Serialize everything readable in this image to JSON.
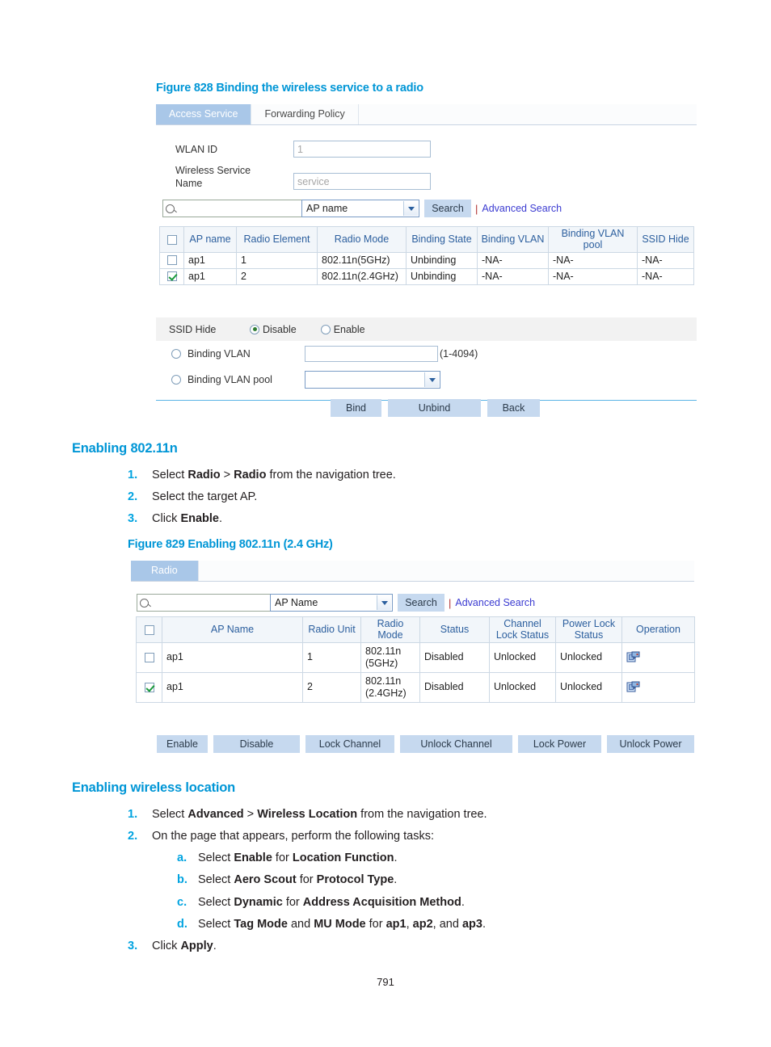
{
  "page": {
    "number": "791"
  },
  "figure828": {
    "caption": "Figure 828 Binding the wireless service to a radio",
    "tabs": [
      {
        "label": "Access Service",
        "active": true
      },
      {
        "label": "Forwarding Policy",
        "active": false
      }
    ],
    "fields": [
      {
        "label": "WLAN ID",
        "value": "1"
      },
      {
        "label": "Wireless Service Name",
        "value": "service"
      }
    ],
    "search": {
      "query": "",
      "criteria": "AP name",
      "button": "Search",
      "advanced_link": "Advanced Search",
      "search_icon": "magnifier-icon"
    },
    "table": {
      "columns": [
        "AP name",
        "Radio Element",
        "Radio Mode",
        "Binding State",
        "Binding VLAN",
        "Binding VLAN pool",
        "SSID Hide"
      ],
      "rows": [
        {
          "checked": false,
          "cells": [
            "ap1",
            "1",
            "802.11n(5GHz)",
            "Unbinding",
            "-NA-",
            "-NA-",
            "-NA-"
          ]
        },
        {
          "checked": true,
          "cells": [
            "ap1",
            "2",
            "802.11n(2.4GHz)",
            "Unbinding",
            "-NA-",
            "-NA-",
            "-NA-"
          ]
        }
      ]
    },
    "ssid_hide": {
      "label": "SSID Hide",
      "options": [
        {
          "label": "Disable",
          "selected": true
        },
        {
          "label": "Enable",
          "selected": false
        }
      ]
    },
    "binding_vlan": {
      "label": "Binding VLAN",
      "selected": false,
      "value": "",
      "range_hint": "(1-4094)"
    },
    "binding_vlan_pool": {
      "label": "Binding VLAN pool",
      "selected": false,
      "value": ""
    },
    "buttons": [
      "Bind",
      "Unbind",
      "Back"
    ]
  },
  "section_80211n": {
    "heading": "Enabling 802.11n",
    "steps": [
      {
        "num": "1.",
        "parts": [
          {
            "t": "Select ",
            "b": false
          },
          {
            "t": "Radio",
            "b": true
          },
          {
            "t": " > ",
            "b": false
          },
          {
            "t": "Radio",
            "b": true
          },
          {
            "t": " from the navigation tree.",
            "b": false
          }
        ]
      },
      {
        "num": "2.",
        "parts": [
          {
            "t": "Select the target AP.",
            "b": false
          }
        ]
      },
      {
        "num": "3.",
        "parts": [
          {
            "t": "Click ",
            "b": false
          },
          {
            "t": "Enable",
            "b": true
          },
          {
            "t": ".",
            "b": false
          }
        ]
      }
    ]
  },
  "figure829": {
    "caption": "Figure 829 Enabling 802.11n (2.4 GHz)",
    "tabs": [
      {
        "label": "Radio",
        "active": true
      }
    ],
    "search": {
      "query": "",
      "criteria": "AP Name",
      "button": "Search",
      "advanced_link": "Advanced Search",
      "search_icon": "magnifier-icon"
    },
    "table": {
      "columns": [
        "AP Name",
        "Radio Unit",
        "Radio Mode",
        "Status",
        "Channel Lock Status",
        "Power Lock Status",
        "Operation"
      ],
      "rows": [
        {
          "checked": false,
          "cells": [
            "ap1",
            "1",
            "802.11n (5GHz)",
            "Disabled",
            "Unlocked",
            "Unlocked"
          ],
          "operation_icon": "edit-config-icon"
        },
        {
          "checked": true,
          "cells": [
            "ap1",
            "2",
            "802.11n (2.4GHz)",
            "Disabled",
            "Unlocked",
            "Unlocked"
          ],
          "operation_icon": "edit-config-icon"
        }
      ]
    },
    "buttons": [
      "Enable",
      "Disable",
      "Lock Channel",
      "Unlock Channel",
      "Lock Power",
      "Unlock Power"
    ]
  },
  "section_wireless_location": {
    "heading": "Enabling wireless location",
    "steps": [
      {
        "num": "1.",
        "parts": [
          {
            "t": "Select ",
            "b": false
          },
          {
            "t": "Advanced",
            "b": true
          },
          {
            "t": " > ",
            "b": false
          },
          {
            "t": "Wireless Location",
            "b": true
          },
          {
            "t": " from the navigation tree.",
            "b": false
          }
        ]
      },
      {
        "num": "2.",
        "parts": [
          {
            "t": "On the page that appears, perform the following tasks:",
            "b": false
          }
        ],
        "substeps": [
          {
            "num": "a.",
            "parts": [
              {
                "t": "Select ",
                "b": false
              },
              {
                "t": "Enable",
                "b": true
              },
              {
                "t": " for ",
                "b": false
              },
              {
                "t": "Location Function",
                "b": true
              },
              {
                "t": ".",
                "b": false
              }
            ]
          },
          {
            "num": "b.",
            "parts": [
              {
                "t": "Select ",
                "b": false
              },
              {
                "t": "Aero Scout",
                "b": true
              },
              {
                "t": " for ",
                "b": false
              },
              {
                "t": "Protocol Type",
                "b": true
              },
              {
                "t": ".",
                "b": false
              }
            ]
          },
          {
            "num": "c.",
            "parts": [
              {
                "t": "Select ",
                "b": false
              },
              {
                "t": "Dynamic",
                "b": true
              },
              {
                "t": " for ",
                "b": false
              },
              {
                "t": "Address Acquisition Method",
                "b": true
              },
              {
                "t": ".",
                "b": false
              }
            ]
          },
          {
            "num": "d.",
            "parts": [
              {
                "t": "Select ",
                "b": false
              },
              {
                "t": "Tag Mode",
                "b": true
              },
              {
                "t": " and ",
                "b": false
              },
              {
                "t": "MU Mode",
                "b": true
              },
              {
                "t": " for ",
                "b": false
              },
              {
                "t": "ap1",
                "b": true
              },
              {
                "t": ", ",
                "b": false
              },
              {
                "t": "ap2",
                "b": true
              },
              {
                "t": ", and ",
                "b": false
              },
              {
                "t": "ap3",
                "b": true
              },
              {
                "t": ".",
                "b": false
              }
            ]
          }
        ]
      },
      {
        "num": "3.",
        "parts": [
          {
            "t": "Click ",
            "b": false
          },
          {
            "t": "Apply",
            "b": true
          },
          {
            "t": ".",
            "b": false
          }
        ]
      }
    ]
  }
}
